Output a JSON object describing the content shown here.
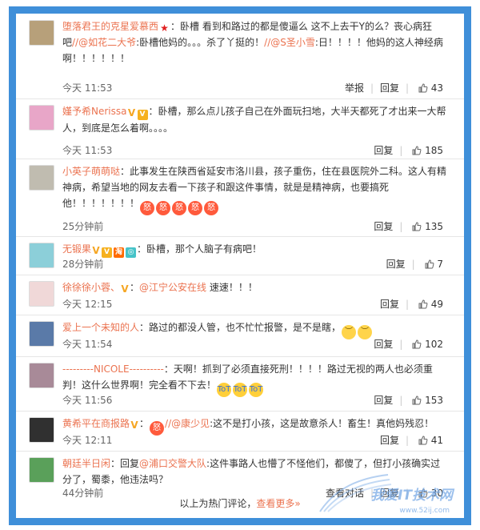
{
  "comments": [
    {
      "user": "堕落君王的克星爱慕西",
      "text1": "：卧槽 看到和路过的都是傻逼么 这不上去干Y的么？丧心病狂吧",
      "mention1": "//@如花二大爷",
      "text2": ":卧槽他妈的。。。杀了丫挺的！",
      "mention2": "//@S圣小雪",
      "text3": ":日！！！！他妈的这人神经病啊！！！！！！",
      "time": "今天 11:53",
      "report": "举报",
      "reply": "回复",
      "likes": "43",
      "avatar_color": "#b7a07a"
    },
    {
      "user": "嫤予希Nerissa",
      "text1": "：卧槽，那么点儿孩子自己在外面玩扫地，大半天都死了才出来一大帮人，到底是怎么着啊。。。。",
      "time": "今天 11:53",
      "reply": "回复",
      "likes": "185",
      "avatar_color": "#e8a6c8"
    },
    {
      "user": "小英子萌萌哒",
      "text1": "：此事发生在陕西省延安市洛川县，孩子重伤，住在县医院外二科。这人有精神病，希望当地的网友去看一下孩子和跟这件事情，就是是精神病，也要搞死他！！！！！！！",
      "time": "25分钟前",
      "reply": "回复",
      "likes": "135",
      "avatar_color": "#c0bcb0"
    },
    {
      "user": "无锻果",
      "text1": "：卧槽，那个人脑子有病吧！",
      "time": "28分钟前",
      "reply": "回复",
      "likes": "7",
      "avatar_color": "#8ccfd9"
    },
    {
      "user": "徐徐徐小蓉、",
      "mention1": "@江宁公安在线",
      "text1": "：",
      "text2": " 速速！！！",
      "time": "今天 12:15",
      "reply": "回复",
      "likes": "49",
      "avatar_color": "#f0d8d8"
    },
    {
      "user": "爱上一个未知的人",
      "text1": "：路过的都没人管，也不忙忙报警，是不是瞎，",
      "time": "今天 11:54",
      "reply": "回复",
      "likes": "102",
      "avatar_color": "#5a7aa8"
    },
    {
      "user": "---------NICOLE----------",
      "text1": "：天啊！抓到了必须直接死刑！！！！路过无视的两人也必须重判！这什么世界啊！完全看不下去！",
      "time": "今天 11:56",
      "reply": "回复",
      "likes": "153",
      "avatar_color": "#a88a98"
    },
    {
      "user": "黄希平在商报路",
      "mention1": "//@康少见",
      "text1": "：",
      "text2": ":这不是打小孩，这是故意杀人！畜生！真他妈残忍！",
      "time": "今天 12:11",
      "reply": "回复",
      "likes": "41",
      "avatar_color": "#303030"
    },
    {
      "user": "朝廷半日闲",
      "text1": "：回复",
      "mention1": "@浦口交警大队",
      "text2": ":这件事路人也懵了不怪他们，都傻了，但打小孩确实过分了，蜀黍，他违法吗？",
      "time": "44分钟前",
      "view_conv": "查看对话",
      "reply": "回复",
      "likes": "30",
      "avatar_color": "#5aa05a"
    }
  ],
  "footer": {
    "text": "以上为热门评论，",
    "link": "查看更多»"
  },
  "watermark": {
    "text": "我爱IT技术网",
    "url": "www.52ij.com"
  },
  "colors": {
    "frame": "#3f8fd9",
    "accent": "#eb7350"
  }
}
